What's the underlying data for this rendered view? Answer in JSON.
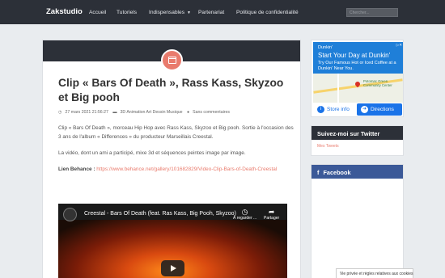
{
  "nav": {
    "brand": "Zakstudio",
    "links": [
      "Accueil",
      "Tutoriels",
      "Indispensables",
      "Partenariat",
      "Politique de confidentialité"
    ],
    "search_placeholder": "Chercher..."
  },
  "post": {
    "title": "Clip « Bars Of Death », Rass Kass, Skyzoo et Big pooh",
    "date": "27 mars 2021 21:56:27",
    "categories": "3D Animation Art Dessin Musique",
    "comments": "Sans commentaires",
    "paragraphs": [
      "Clip « Bars Of Death », morceau Hip Hop avec Rass Kass, Skyzoo et Big pooh. Sortie à l'occasion des 3 ans de l'album « Differences » du producteur Marseillais Creestal.",
      "La vidéo, dont un ami a participé, mixe 3d et séquences peintes image par image."
    ],
    "behance_label": "Lien Behance :",
    "behance_url": "https://www.behance.net/gallery/101682829/Video-Clip-Bars-of-Death-Creestal"
  },
  "video": {
    "title": "Creestal - Bars Of Death (feat. Ras Kass, Big Pooh, Skyzoo)",
    "watch_later": "À regarder ...",
    "share": "Partager"
  },
  "ad": {
    "brand": "Dunkin'",
    "headline": "Start Your Day at Dunkin'",
    "text": "Try Our Famous Hot or Iced Coffee at a Dunkin' Near You.",
    "place": "Potomac Green Community Center",
    "store_info": "Store info",
    "directions": "Directions"
  },
  "sidebar": {
    "twitter_title": "Suivez-moi sur Twitter",
    "twitter_link": "Mes Tweets",
    "facebook_title": "Facebook"
  },
  "cookie": "Vie privée et règles relatives aux cookies",
  "colors": {
    "accent": "#e97b6d",
    "nav_bg": "#2c3038",
    "facebook": "#3b5998"
  }
}
